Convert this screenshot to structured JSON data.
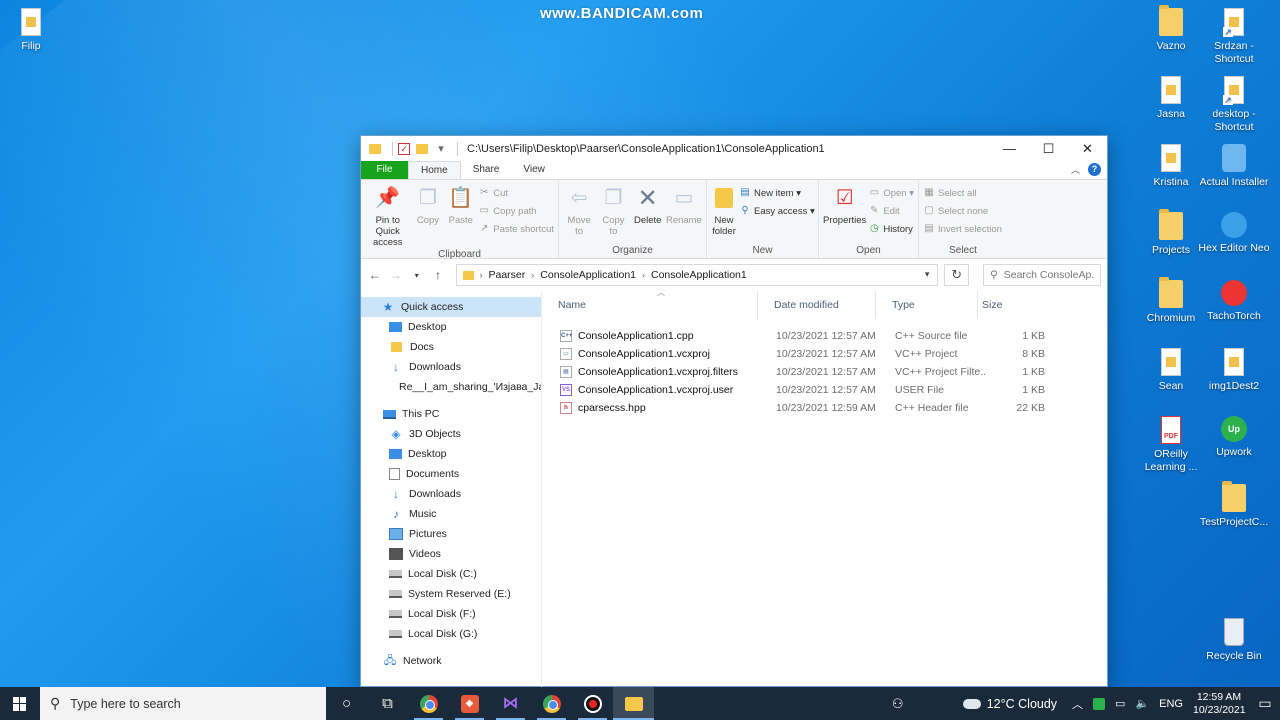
{
  "watermark": "www.BANDICAM.com",
  "desktop_icons": {
    "filip": "Filip",
    "vazno": "Vazno",
    "srdzan": "Srdzan - Shortcut",
    "jasna": "Jasna",
    "desktop_shortcut": "desktop - Shortcut",
    "kristina": "Kristina",
    "actual_installer": "Actual Installer",
    "projects": "Projects",
    "hex_editor": "Hex Editor Neo",
    "chromium": "Chromium",
    "tachotorch": "TachoTorch",
    "sean": "Sean",
    "img1dest2": "img1Dest2",
    "oreilly": "OReilly Learning ...",
    "upwork": "Upwork",
    "upwork_glyph": "Up",
    "pdf_glyph": "PDF",
    "testproject": "TestProjectC...",
    "recycle_bin": "Recycle Bin"
  },
  "window": {
    "title_path": "C:\\Users\\Filip\\Desktop\\Paarser\\ConsoleApplication1\\ConsoleApplication1",
    "tabs": {
      "file": "File",
      "home": "Home",
      "share": "Share",
      "view": "View"
    },
    "ribbon": {
      "clipboard": {
        "label": "Clipboard",
        "pin": "Pin to Quick access",
        "copy": "Copy",
        "paste": "Paste",
        "cut": "Cut",
        "copy_path": "Copy path",
        "paste_shortcut": "Paste shortcut"
      },
      "organize": {
        "label": "Organize",
        "move_to": "Move to",
        "copy_to": "Copy to",
        "delete": "Delete",
        "rename": "Rename"
      },
      "new": {
        "label": "New",
        "new_folder": "New folder",
        "new_item": "New item",
        "easy_access": "Easy access"
      },
      "open": {
        "label": "Open",
        "properties": "Properties",
        "open": "Open",
        "edit": "Edit",
        "history": "History"
      },
      "select": {
        "label": "Select",
        "select_all": "Select all",
        "select_none": "Select none",
        "invert": "Invert selection"
      }
    },
    "address": {
      "crumbs": [
        "Paarser",
        "ConsoleApplication1",
        "ConsoleApplication1"
      ],
      "search_placeholder": "Search ConsoleAp..."
    },
    "nav": {
      "quick_access": "Quick access",
      "qa_items": [
        "Desktop",
        "Docs",
        "Downloads",
        "Re__I_am_sharing_'Изјава_Јасн"
      ],
      "this_pc": "This PC",
      "pc_items": [
        "3D Objects",
        "Desktop",
        "Documents",
        "Downloads",
        "Music",
        "Pictures",
        "Videos",
        "Local Disk (C:)",
        "System Reserved (E:)",
        "Local Disk (F:)",
        "Local Disk (G:)"
      ],
      "network": "Network"
    },
    "columns": {
      "name": "Name",
      "date": "Date modified",
      "type": "Type",
      "size": "Size"
    },
    "files": [
      {
        "name": "ConsoleApplication1.cpp",
        "date": "10/23/2021 12:57 AM",
        "type": "C++ Source file",
        "size": "1 KB",
        "glyph": "C++"
      },
      {
        "name": "ConsoleApplication1.vcxproj",
        "date": "10/23/2021 12:57 AM",
        "type": "VC++ Project",
        "size": "8 KB",
        "glyph": "▭"
      },
      {
        "name": "ConsoleApplication1.vcxproj.filters",
        "date": "10/23/2021 12:57 AM",
        "type": "VC++ Project Filte...",
        "size": "1 KB",
        "glyph": "▤"
      },
      {
        "name": "ConsoleApplication1.vcxproj.user",
        "date": "10/23/2021 12:57 AM",
        "type": "USER File",
        "size": "1 KB",
        "glyph": "VS"
      },
      {
        "name": "cparsecss.hpp",
        "date": "10/23/2021 12:59 AM",
        "type": "C++ Header file",
        "size": "22 KB",
        "glyph": "h"
      }
    ]
  },
  "taskbar": {
    "search_placeholder": "Type here to search",
    "weather": "12°C  Cloudy",
    "lang": "ENG",
    "time": "12:59 AM",
    "date": "10/23/2021"
  }
}
